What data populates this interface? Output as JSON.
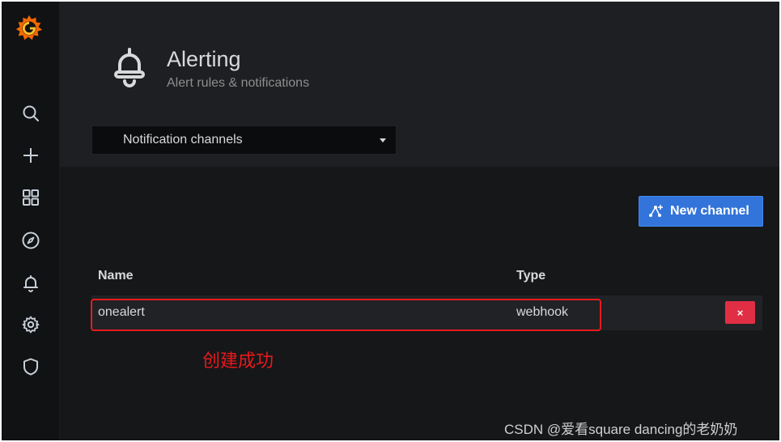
{
  "header": {
    "title": "Alerting",
    "subtitle": "Alert rules & notifications"
  },
  "nav": {
    "selected": "Notification channels"
  },
  "actions": {
    "new_channel_label": "New channel"
  },
  "table": {
    "columns": [
      "Name",
      "Type"
    ],
    "rows": [
      {
        "name": "onealert",
        "type": "webhook",
        "delete_label": "×"
      }
    ]
  },
  "annotation": {
    "text": "创建成功",
    "color": "#e8191c"
  },
  "watermark": "CSDN @爱看square dancing的老奶奶",
  "colors": {
    "accent": "#3274d9",
    "danger": "#e02f44",
    "logo": "#f46800"
  },
  "icons": [
    "grafana-logo-icon",
    "search-icon",
    "plus-icon",
    "dashboards-icon",
    "explore-icon",
    "bell-icon",
    "gear-icon",
    "shield-icon"
  ]
}
